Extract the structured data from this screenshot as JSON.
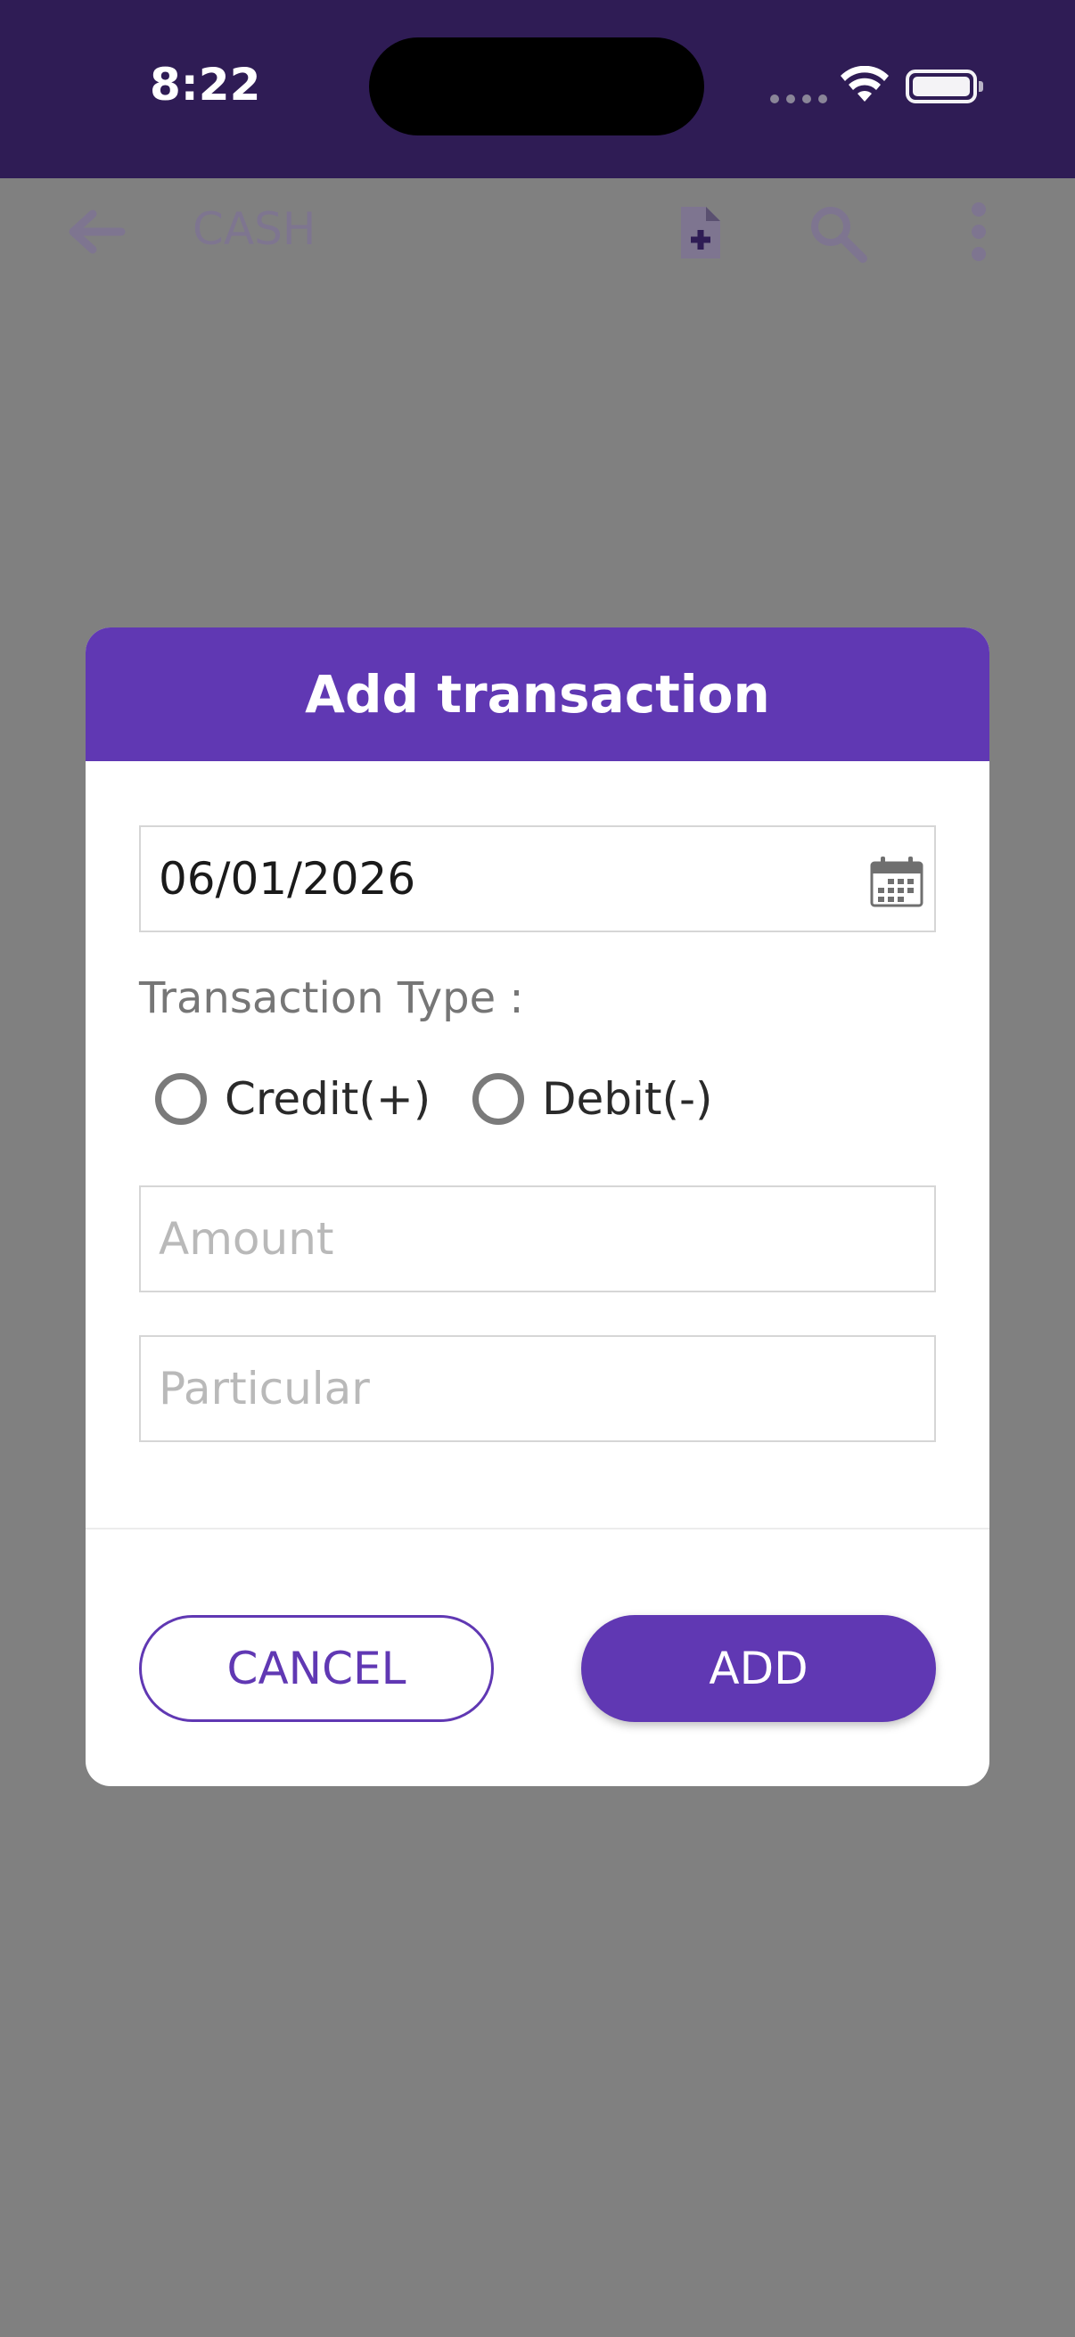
{
  "status_bar": {
    "time": "8:22"
  },
  "app_bar": {
    "title": "CASH",
    "icons": [
      "arrow-back-icon",
      "file-add-icon",
      "search-icon",
      "more-vertical-icon"
    ]
  },
  "dialog": {
    "title": "Add transaction",
    "date_value": "06/01/2026",
    "transaction_type_label": "Transaction Type :",
    "radio_options": [
      {
        "label": "Credit(+)",
        "selected": false
      },
      {
        "label": "Debit(-)",
        "selected": false
      }
    ],
    "amount_placeholder": "Amount",
    "particular_placeholder": "Particular",
    "cancel_label": "CANCEL",
    "add_label": "ADD"
  },
  "colors": {
    "primary": "#6038b3",
    "scrim": "#808080",
    "appbar_dimmed": "#2f1c55"
  }
}
